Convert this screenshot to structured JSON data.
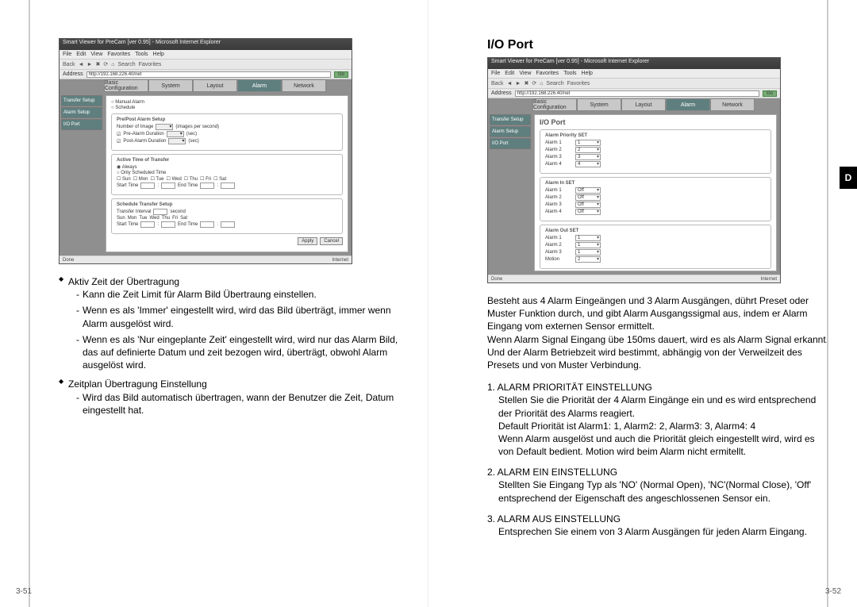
{
  "left_page_number": "3-51",
  "right_page_number": "3-52",
  "side_tab": "D",
  "right_heading": "I/O Port",
  "shot_common": {
    "titlebar": "Smart Viewer for PreCam [ver 0.95] - Microsoft Internet Explorer",
    "menu": [
      "File",
      "Edit",
      "View",
      "Favorites",
      "Tools",
      "Help"
    ],
    "toolbar": [
      "Back",
      "",
      "",
      "",
      "",
      "Search",
      "Favorites"
    ],
    "address_label": "Address",
    "address_value": "http://192.168.226.40/net",
    "go": "Go",
    "status_left": "Done",
    "status_right": "Internet",
    "tabs": [
      "Basic Configuration",
      "System",
      "Layout",
      "Alarm",
      "Network"
    ],
    "active_tab": 3,
    "side_nav": [
      "Transfer Setup",
      "Alarm Setup",
      "I/O Port"
    ]
  },
  "shot1": {
    "radio_manual": "Manual Alarm",
    "radio_schedule": "Schedule",
    "grp1_title": "Pre/Post Alarm Setup",
    "g1_r1_label": "Number of Image",
    "g1_r1_unit": "(images per second)",
    "g1_r2_label": "Pre-Alarm Duration",
    "g1_r2_unit": "(sec)",
    "g1_r3_label": "Post-Alarm Duration",
    "g1_r3_unit": "(sec)",
    "grp2_title": "Active Time of Transfer",
    "g2_r1": "Always",
    "g2_r2": "Only Scheduled Time",
    "days": [
      "Sun",
      "Mon",
      "Tue",
      "Wed",
      "Thu",
      "Fri",
      "Sat"
    ],
    "start_time": "Start Time",
    "end_time": "End Time",
    "grp3_title": "Schedule Transfer Setup",
    "g3_interval": "Transfer Interval",
    "g3_interval_unit": "second",
    "apply": "Apply",
    "cancel": "Cancel"
  },
  "shot2": {
    "page_title": "I/O Port",
    "sec1": "Alarm Priority SET",
    "rows1": [
      {
        "lbl": "Alarm 1",
        "val": "1"
      },
      {
        "lbl": "Alarm 2",
        "val": "2"
      },
      {
        "lbl": "Alarm 3",
        "val": "3"
      },
      {
        "lbl": "Alarm 4",
        "val": "4"
      }
    ],
    "sec2": "Alarm In SET",
    "rows2": [
      {
        "lbl": "Alarm 1",
        "val": "Off"
      },
      {
        "lbl": "Alarm 2",
        "val": "Off"
      },
      {
        "lbl": "Alarm 3",
        "val": "Off"
      },
      {
        "lbl": "Alarm 4",
        "val": "Off"
      }
    ],
    "sec3": "Alarm Out SET",
    "rows3": [
      {
        "lbl": "Alarm 1",
        "val": "1"
      },
      {
        "lbl": "Alarm 2",
        "val": "1"
      },
      {
        "lbl": "Alarm 3",
        "val": "1"
      },
      {
        "lbl": "Motion",
        "val": "2"
      }
    ]
  },
  "left_text": {
    "b1_title": "Aktiv Zeit der Übertragung",
    "b1_s1": "Kann die Zeit Limit für Alarm Bild Übertraung einstellen.",
    "b1_s2": "Wenn es als 'Immer' eingestellt wird, wird das Bild überträgt, immer wenn Alarm ausgelöst wird.",
    "b1_s3": "Wenn es als 'Nur eingeplante Zeit' eingestellt wird, wird nur das Alarm Bild, das auf definierte Datum und zeit bezogen wird, überträgt, obwohl Alarm ausgelöst wird.",
    "b2_title": "Zeitplan Übertragung Einstellung",
    "b2_s1": "Wird das Bild automatisch übertragen, wann der Benutzer die Zeit, Datum eingestellt hat."
  },
  "right_text": {
    "intro": "Besteht aus 4 Alarm Eingeängen und 3 Alarm Ausgängen, dührt Preset oder Muster Funktion durch, und gibt Alarm Ausgangssigmal aus, indem er Alarm Eingang vom externen Sensor ermittelt.\nWenn Alarm Signal Eingang übe 150ms dauert, wird es als Alarm Signal erkannt. Und der Alarm Betriebzeit wird bestimmt, abhängig von der Verweilzeit des Presets und von Muster Verbindung.",
    "n1_hd": "1. ALARM PRIORITÄT EINSTELLUNG",
    "n1_txt": "Stellen Sie die Priorität der 4 Alarm Eingänge ein und es wird entsprechend der Priorität des Alarms reagiert.\nDefault Priorität ist Alarm1: 1, Alarm2: 2, Alarm3: 3, Alarm4: 4\nWenn Alarm ausgelöst und auch die Priorität gleich eingestellt wird, wird es von Default bedient. Motion wird beim Alarm nicht ermitellt.",
    "n2_hd": "2. ALARM EIN EINSTELLUNG",
    "n2_txt": "Stellten Sie Eingang Typ als 'NO' (Normal Open), 'NC'(Normal Close), 'Off' entsprechend der Eigenschaft des angeschlossenen Sensor ein.",
    "n3_hd": "3. ALARM AUS EINSTELLUNG",
    "n3_txt": "Entsprechen Sie einem von 3 Alarm Ausgängen für jeden Alarm Eingang."
  }
}
